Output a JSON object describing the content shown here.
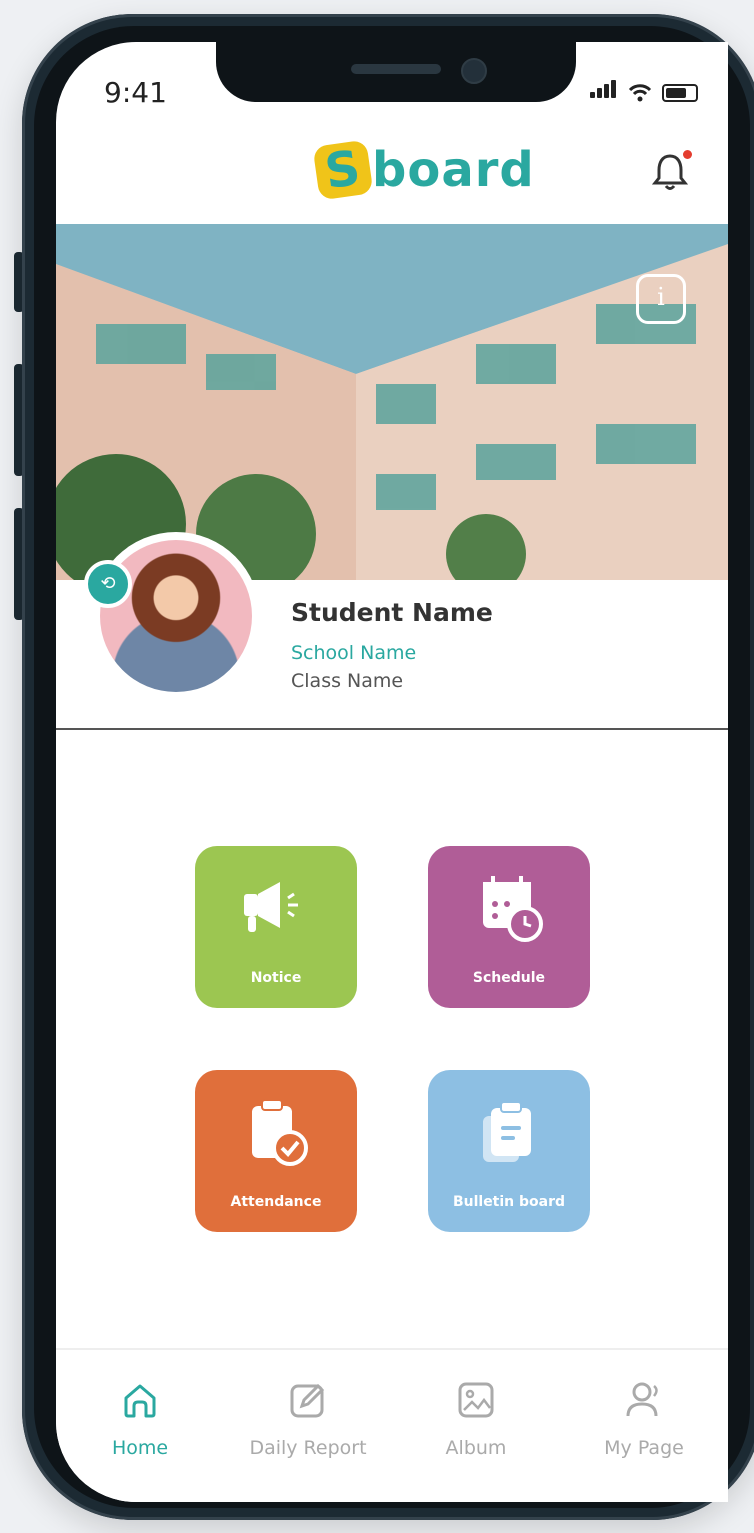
{
  "status_bar": {
    "time": "9:41"
  },
  "header": {
    "logo_text": "Sboard",
    "notification_dot_color": "#e43d2f"
  },
  "profile": {
    "student_name": "Student Name",
    "school_name": "School Name",
    "class_name": "Class Name"
  },
  "tiles": [
    {
      "label": "Notice",
      "color": "#9cc651",
      "icon": "megaphone-icon"
    },
    {
      "label": "Schedule",
      "color": "#b05d97",
      "icon": "calendar-clock-icon"
    },
    {
      "label": "Attendance",
      "color": "#e06f3b",
      "icon": "clipboard-check-icon"
    },
    {
      "label": "Bulletin board",
      "color": "#8dbfe3",
      "icon": "clipboard-list-icon"
    }
  ],
  "tabbar": {
    "items": [
      {
        "label": "Home",
        "icon": "home-icon",
        "active": true
      },
      {
        "label": "Daily Report",
        "icon": "edit-icon",
        "active": false
      },
      {
        "label": "Album",
        "icon": "image-icon",
        "active": false
      },
      {
        "label": "My Page",
        "icon": "user-icon",
        "active": false
      }
    ]
  },
  "accent_color": "#2aa8a0"
}
